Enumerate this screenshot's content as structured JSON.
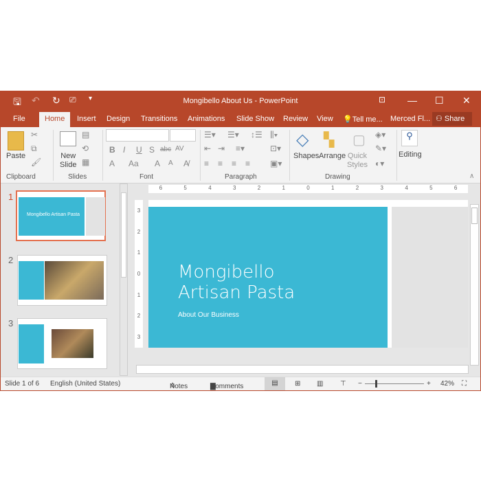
{
  "window": {
    "title": "Mongibello About Us - PowerPoint",
    "accent": "#B7472A"
  },
  "tabs": [
    "File",
    "Home",
    "Insert",
    "Design",
    "Transitions",
    "Animations",
    "Slide Show",
    "Review",
    "View",
    "Tell me...",
    "Merced Fl...",
    "Share"
  ],
  "ribbon": {
    "paste": "Paste",
    "new_slide_1": "New",
    "new_slide_2": "Slide",
    "shapes": "Shapes",
    "arrange": "Arrange",
    "quick_styles_1": "Quick",
    "quick_styles_2": "Styles",
    "editing": "Editing",
    "groups": [
      "Clipboard",
      "Slides",
      "Font",
      "Paragraph",
      "Drawing"
    ],
    "font_buttons": [
      "B",
      "I",
      "U",
      "S",
      "abc",
      "AV",
      "A",
      "Aa",
      "A",
      "A"
    ]
  },
  "thumbnails": [
    {
      "num": "1",
      "title": "Mongibello Artisan Pasta"
    },
    {
      "num": "2"
    },
    {
      "num": "3"
    }
  ],
  "slide": {
    "title": "Mongibello Artisan Pasta",
    "subtitle": "About Our Business",
    "color": "#3BB8D4"
  },
  "ruler": {
    "top": [
      "6",
      "5",
      "4",
      "3",
      "2",
      "1",
      "0",
      "1",
      "2",
      "3",
      "4",
      "5",
      "6"
    ],
    "left": [
      "3",
      "2",
      "1",
      "0",
      "1",
      "2",
      "3"
    ]
  },
  "status": {
    "slide": "Slide 1 of 6",
    "language": "English (United States)",
    "notes": "Notes",
    "comments": "Comments",
    "zoom": "42%",
    "zoom_level": 0.42
  }
}
